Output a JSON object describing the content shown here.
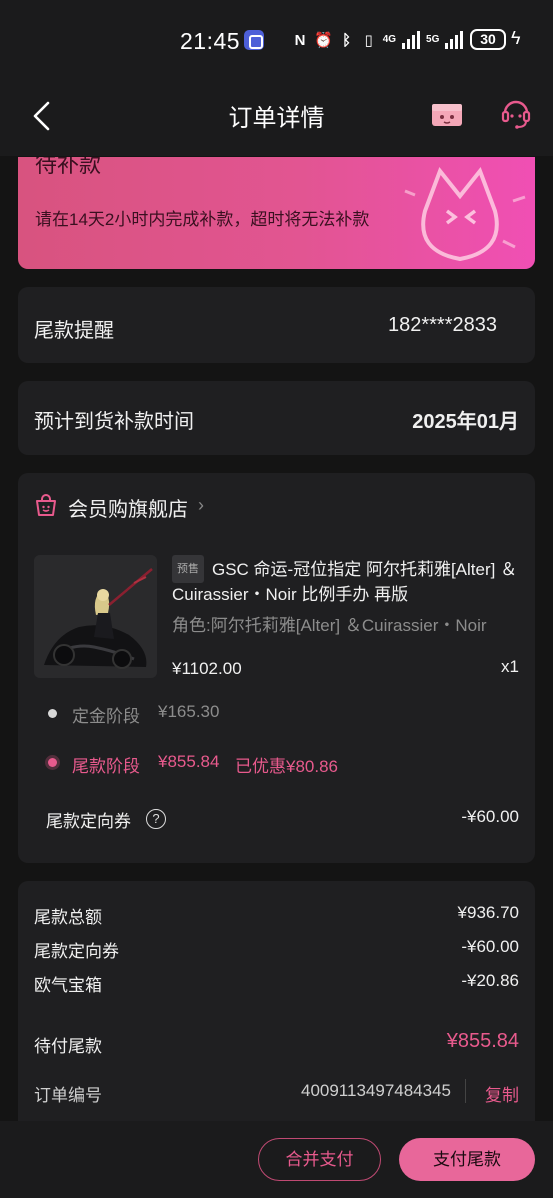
{
  "status_bar": {
    "time": "21:45",
    "network": "4G",
    "network2": "5G",
    "battery": "30"
  },
  "nav": {
    "title": "订单详情",
    "icons": [
      "back-icon",
      "mystery-box-icon",
      "customer-service-icon"
    ]
  },
  "banner": {
    "status": "待补款",
    "message": "请在14天2小时内完成补款，超时将无法补款"
  },
  "reminder": {
    "label": "尾款提醒",
    "phone": "182****2833"
  },
  "arrival": {
    "label": "预计到货补款时间",
    "value": "2025年01月"
  },
  "store": {
    "name": "会员购旗舰店",
    "chevron": "›"
  },
  "product": {
    "tag": "预售",
    "title": "GSC 命运-冠位指定 阿尔托莉雅[Alter] ＆Cuirassier・Noir 比例手办 再版",
    "spec": "角色:阿尔托莉雅[Alter] ＆Cuirassier・Noir",
    "price": "¥1102.00",
    "qty": "x1"
  },
  "stages": {
    "deposit_label": "定金阶段",
    "deposit_value": "¥165.30",
    "final_label": "尾款阶段",
    "final_value": "¥855.84",
    "final_discount": "已优惠¥80.86"
  },
  "coupon": {
    "label": "尾款定向券",
    "help": "?",
    "value": "-¥60.00"
  },
  "summary": {
    "rows": [
      {
        "label": "尾款总额",
        "value": "¥936.70"
      },
      {
        "label": "尾款定向券",
        "value": "-¥60.00"
      },
      {
        "label": "欧气宝箱",
        "value": "-¥20.86"
      }
    ],
    "due_label": "待付尾款",
    "due_value": "¥855.84",
    "order_label": "订单编号",
    "order_no": "4009113497484345",
    "copy_label": "复制"
  },
  "actions": {
    "merge_label": "合并支付",
    "pay_label": "支付尾款"
  },
  "colors": {
    "accent": "#e85a8d",
    "background": "#141414",
    "card": "#1f1f21",
    "muted": "#8c8c8c"
  }
}
